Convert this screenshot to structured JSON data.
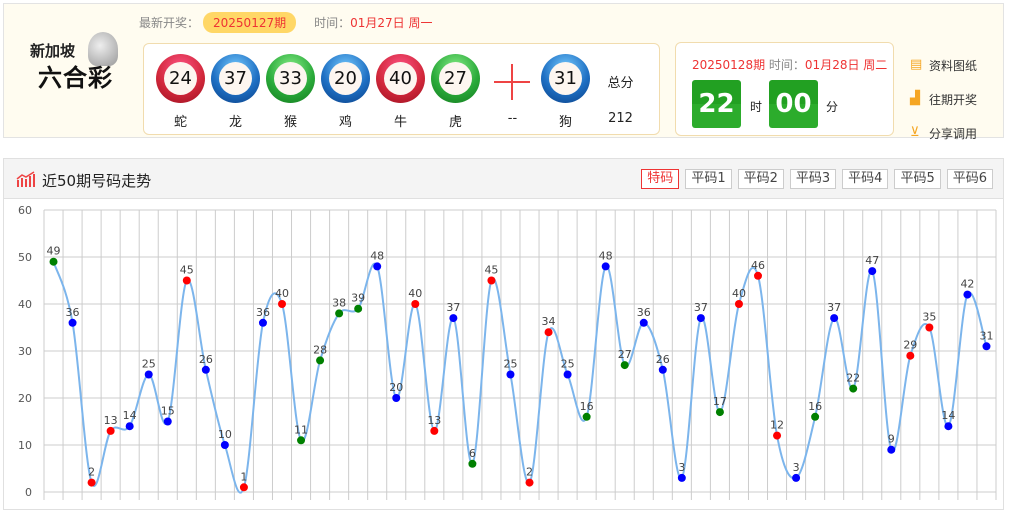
{
  "logo": {
    "line1": "新加坡",
    "line2": "六合彩"
  },
  "latest": {
    "label": "最新开奖：",
    "issue": "20250127期",
    "time_label": "时间：",
    "time": "01月27日 周一"
  },
  "balls": [
    {
      "num": "24",
      "zodiac": "蛇",
      "color": "red"
    },
    {
      "num": "37",
      "zodiac": "龙",
      "color": "blue"
    },
    {
      "num": "33",
      "zodiac": "猴",
      "color": "green"
    },
    {
      "num": "20",
      "zodiac": "鸡",
      "color": "blue"
    },
    {
      "num": "40",
      "zodiac": "牛",
      "color": "red"
    },
    {
      "num": "27",
      "zodiac": "虎",
      "color": "green"
    }
  ],
  "plus_label": "--",
  "special": {
    "num": "31",
    "zodiac": "狗",
    "color": "blue"
  },
  "total": {
    "label": "总分",
    "value": "212"
  },
  "next": {
    "issue": "20250128期",
    "time_label": " 时间：",
    "time": "01月28日 周二",
    "hours": "22",
    "hour_unit": "时",
    "minutes": "00",
    "minute_unit": "分"
  },
  "links": [
    {
      "label": "资料图纸",
      "icon": "document-icon"
    },
    {
      "label": "往期开奖",
      "icon": "bar-chart-icon"
    },
    {
      "label": "分享调用",
      "icon": "monitor-download-icon"
    }
  ],
  "panel": {
    "title": "近50期号码走势",
    "tabs": [
      "特码",
      "平码1",
      "平码2",
      "平码3",
      "平码4",
      "平码5",
      "平码6"
    ],
    "active_tab": 0
  },
  "wave_colors": {
    "red": "#ff0000",
    "blue": "#0000ff",
    "green": "#008000",
    "line": "#7cb5ec"
  },
  "chart_data": {
    "type": "line",
    "ylim": [
      0,
      60
    ],
    "yticks": [
      0,
      10,
      20,
      30,
      40,
      50,
      60
    ],
    "grid": true,
    "values": [
      49,
      36,
      2,
      13,
      14,
      25,
      15,
      45,
      26,
      10,
      1,
      36,
      40,
      11,
      28,
      38,
      39,
      48,
      20,
      40,
      13,
      37,
      6,
      45,
      25,
      2,
      34,
      25,
      16,
      48,
      27,
      36,
      26,
      3,
      37,
      17,
      40,
      46,
      12,
      3,
      16,
      37,
      22,
      47,
      9,
      29,
      35,
      14,
      42,
      31
    ]
  }
}
